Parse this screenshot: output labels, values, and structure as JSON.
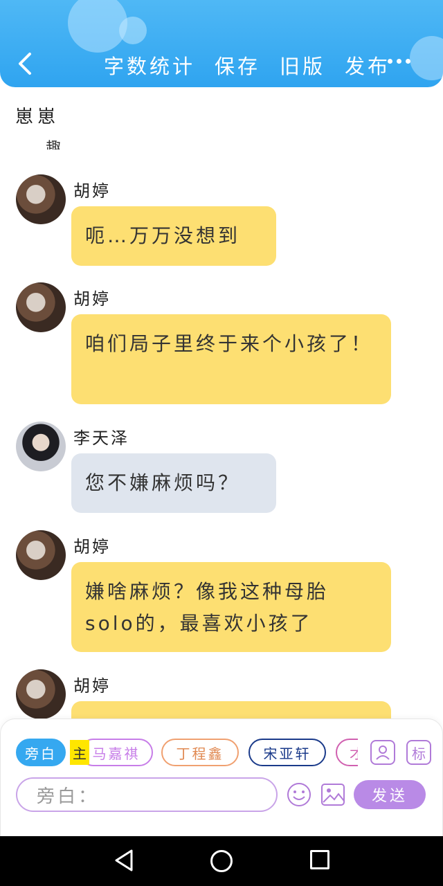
{
  "header": {
    "toolbar": [
      "字数统计",
      "保存",
      "旧版",
      "发布"
    ]
  },
  "chat": {
    "intro_text": "崽崽",
    "intro_fragment": "趣",
    "messages": [
      {
        "name": "胡婷",
        "avatar": "female-avatar",
        "text": "呃…万万没想到",
        "color": "#fddf72"
      },
      {
        "name": "胡婷",
        "avatar": "female-avatar",
        "text": "咱们局子里终于来个小孩了！",
        "color": "#fddf72"
      },
      {
        "name": "李天泽",
        "avatar": "male-avatar",
        "text": "您不嫌麻烦吗？",
        "color": "#dfe5ee"
      },
      {
        "name": "胡婷",
        "avatar": "female-avatar",
        "text": "嫌啥麻烦？像我这种母胎solo的，最喜欢小孩了",
        "color": "#fddf72"
      },
      {
        "name": "胡婷",
        "avatar": "female-avatar",
        "text": "",
        "color": "#fddf72"
      }
    ]
  },
  "composer": {
    "characters": [
      "旁白",
      "马嘉祺",
      "丁程鑫",
      "宋亚轩",
      "才"
    ],
    "main_tag": "主",
    "tag_label": "标",
    "input_placeholder": "旁白：",
    "send_label": "发送"
  },
  "colors": {
    "header": "#2fa4f0",
    "bubble_self": "#fddf72",
    "bubble_other": "#dfe5ee",
    "send_button": "#b98ae6"
  }
}
